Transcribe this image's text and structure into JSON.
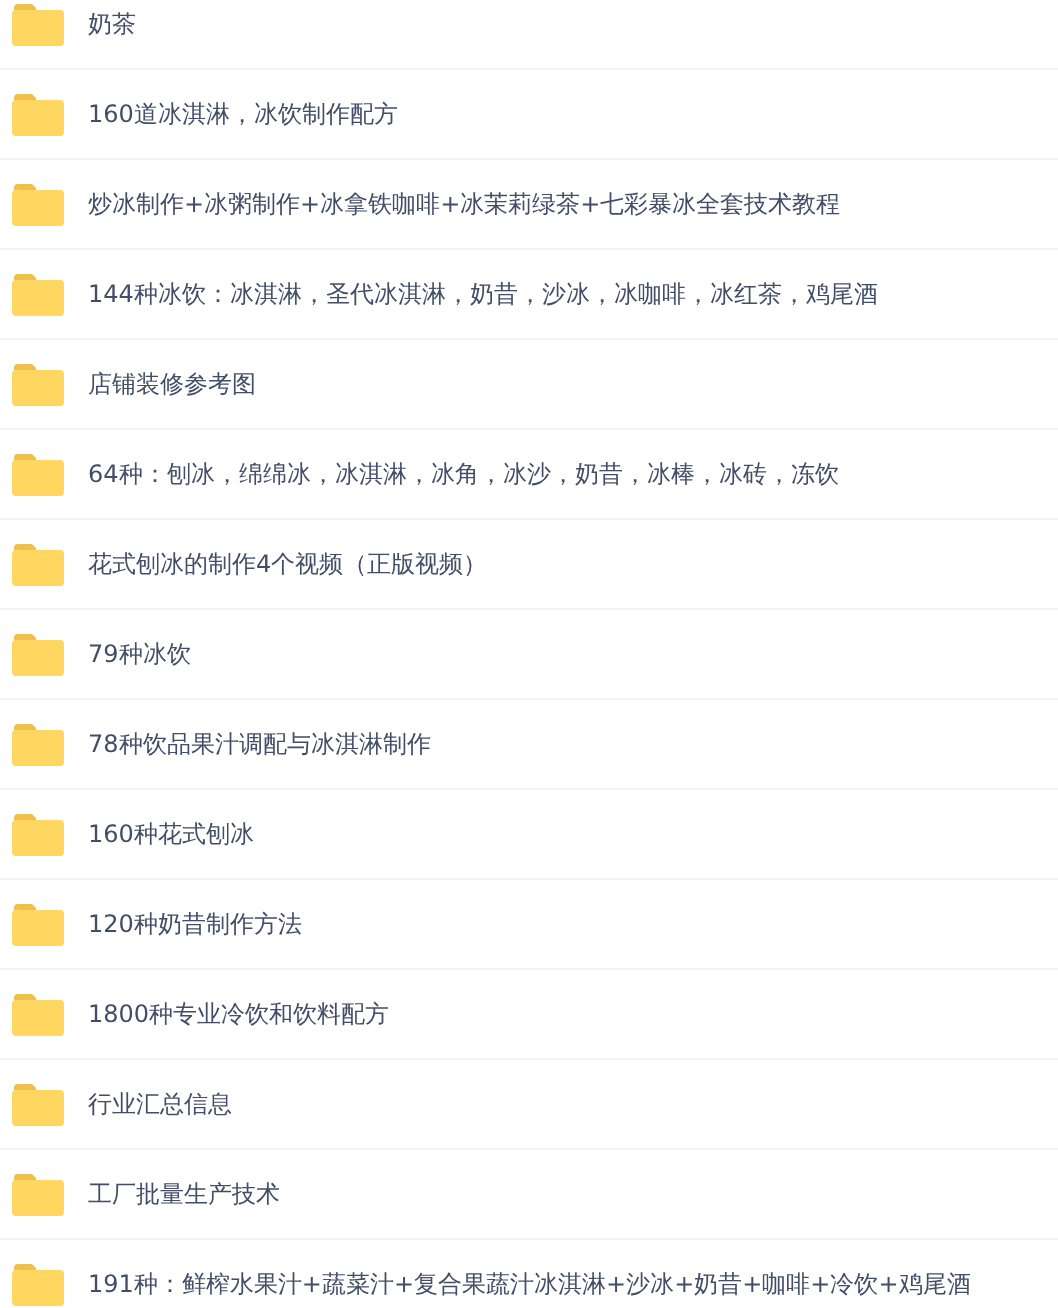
{
  "folders": [
    {
      "name": "奶茶"
    },
    {
      "name": "160道冰淇淋，冰饮制作配方"
    },
    {
      "name": "炒冰制作+冰粥制作+冰拿铁咖啡+冰茉莉绿茶+七彩暴冰全套技术教程"
    },
    {
      "name": "144种冰饮：冰淇淋，圣代冰淇淋，奶昔，沙冰，冰咖啡，冰红茶，鸡尾酒"
    },
    {
      "name": "店铺装修参考图"
    },
    {
      "name": "64种：刨冰，绵绵冰，冰淇淋，冰角，冰沙，奶昔，冰棒，冰砖，冻饮"
    },
    {
      "name": "花式刨冰的制作4个视频（正版视频）"
    },
    {
      "name": "79种冰饮"
    },
    {
      "name": "78种饮品果汁调配与冰淇淋制作"
    },
    {
      "name": "160种花式刨冰"
    },
    {
      "name": "120种奶昔制作方法"
    },
    {
      "name": "1800种专业冷饮和饮料配方"
    },
    {
      "name": "行业汇总信息"
    },
    {
      "name": "工厂批量生产技术"
    },
    {
      "name": "191种：鲜榨水果汁+蔬菜汁+复合果蔬汁冰淇淋+沙冰+奶昔+咖啡+冷饮+鸡尾酒"
    }
  ]
}
